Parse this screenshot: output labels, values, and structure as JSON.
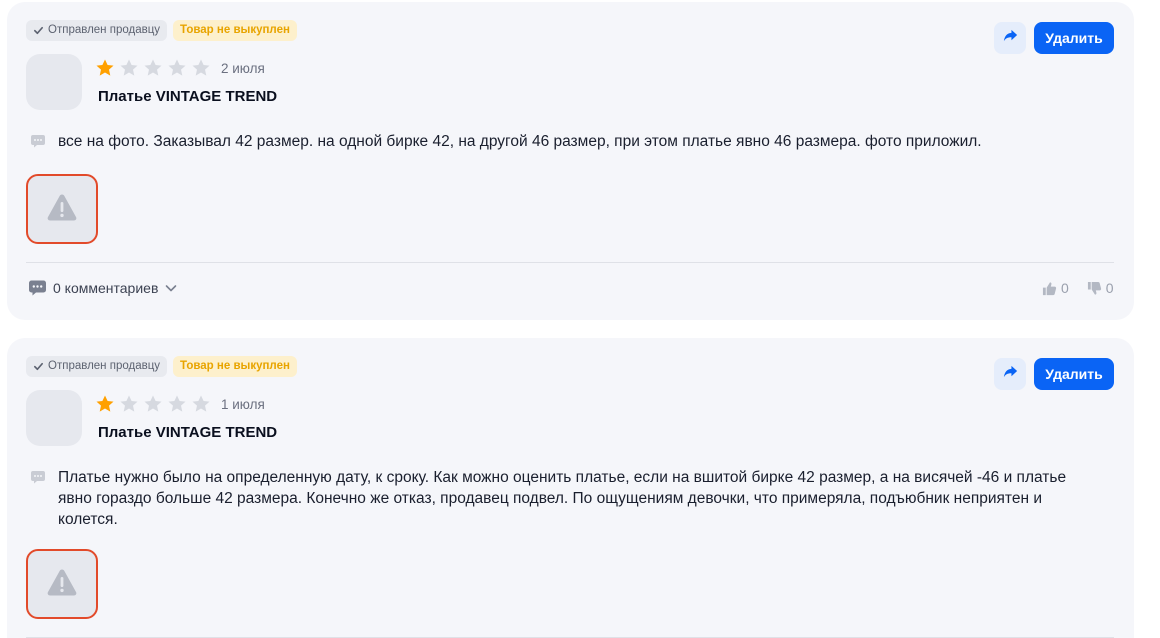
{
  "reviews": [
    {
      "status_sent": "Отправлен продавцу",
      "status_warn": "Товар не выкуплен",
      "delete_label": "Удалить",
      "rating": 1,
      "date": "2 июля",
      "product": "Платье VINTAGE TREND",
      "text": "все на фото. Заказывал 42 размер. на одной бирке 42, на другой 46 размер, при этом платье явно 46 размера. фото приложил.",
      "comments_label": "0 комментариев",
      "likes": "0",
      "dislikes": "0"
    },
    {
      "status_sent": "Отправлен продавцу",
      "status_warn": "Товар не выкуплен",
      "delete_label": "Удалить",
      "rating": 1,
      "date": "1 июля",
      "product": "Платье VINTAGE TREND",
      "text": "Платье нужно было на определенную дату, к сроку. Как можно оценить платье, если на вшитой бирке 42 размер, а на висячей -46 и платье явно гораздо больше 42 размера. Конечно же отказ, продавец подвел. По ощущениям девочки, что примеряла, подъюбник неприятен и колется."
    }
  ],
  "icons": {
    "check": "check-icon",
    "share": "share-arrow-icon",
    "star": "star-icon",
    "bubble": "comment-bubble-icon",
    "warning": "warning-triangle-icon",
    "chevron": "chevron-down-icon",
    "like": "thumbs-up-icon",
    "dislike": "thumbs-down-icon"
  },
  "colors": {
    "card_bg": "#f5f6fa",
    "primary": "#0a64f5",
    "star_filled": "#ffa000",
    "star_empty": "#d6d9e0",
    "warn_bg": "#fdf0cc",
    "warn_text": "#e8a400",
    "photo_border": "#e24a2a"
  }
}
